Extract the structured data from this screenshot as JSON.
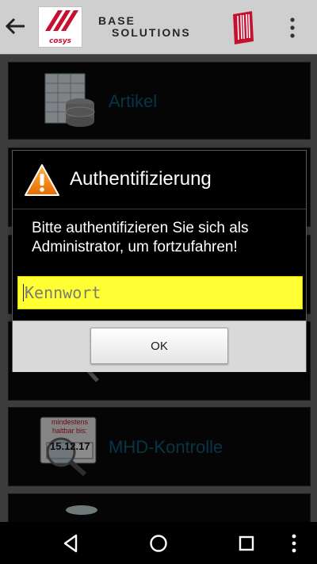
{
  "app_bar": {
    "logo_text": "cosys",
    "brand_line1": "BASE",
    "brand_line2": "SOLUTIONS",
    "icons": [
      "back-arrow-icon",
      "cosys-logo",
      "barcode-icon",
      "overflow-menu-icon"
    ]
  },
  "list": {
    "items": [
      {
        "label": "Artikel",
        "icon": "database-table-icon"
      },
      {
        "label": "",
        "icon": "inventory-icon"
      },
      {
        "label": "",
        "icon": "list-icon"
      },
      {
        "label": "",
        "icon": "magnifier-icon"
      },
      {
        "label": "MHD-Kontrolle",
        "icon": "best-before-magnifier-icon",
        "icon_text": "mindestens haltbar bis:",
        "icon_date": "15.12.17"
      },
      {
        "label": "",
        "icon": "bottle-icon"
      }
    ]
  },
  "dialog": {
    "title": "Authentifizierung",
    "icon": "warning-icon",
    "message": "Bitte authentifizieren Sie sich als Administrator, um fortzufahren!",
    "password_placeholder": "Kennwort",
    "password_value": "",
    "ok_label": "OK",
    "input_color": "#ffff33"
  },
  "nav_bar": {
    "icons": [
      "back-triangle-icon",
      "home-circle-icon",
      "recents-square-icon",
      "overflow-dots-icon"
    ]
  }
}
